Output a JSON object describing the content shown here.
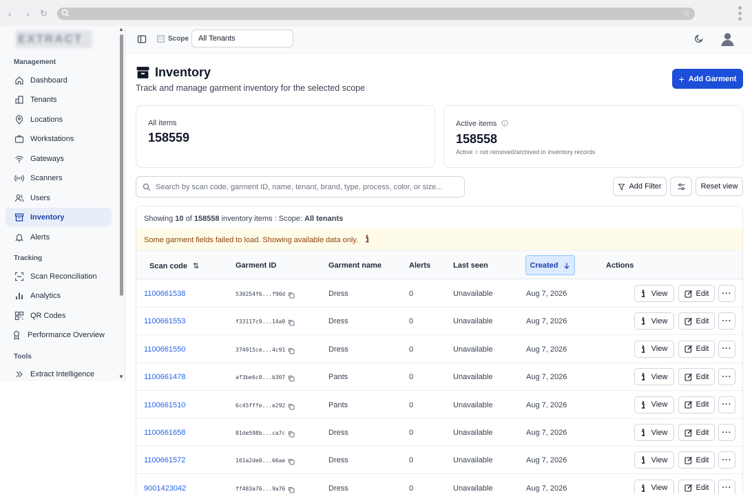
{
  "sidebar": {
    "logo_text": "EXTRACT",
    "sections": {
      "management": "Management",
      "tracking": "Tracking",
      "tools": "Tools"
    },
    "items": [
      {
        "label": "Dashboard",
        "icon": "home-icon"
      },
      {
        "label": "Tenants",
        "icon": "building-icon"
      },
      {
        "label": "Locations",
        "icon": "map-pin-icon"
      },
      {
        "label": "Workstations",
        "icon": "briefcase-icon"
      },
      {
        "label": "Gateways",
        "icon": "wifi-icon"
      },
      {
        "label": "Scanners",
        "icon": "radio-icon"
      },
      {
        "label": "Users",
        "icon": "users-icon"
      },
      {
        "label": "Inventory",
        "icon": "archive-icon"
      },
      {
        "label": "Alerts",
        "icon": "bell-icon"
      },
      {
        "label": "Scan Reconciliation",
        "icon": "scan-icon"
      },
      {
        "label": "Analytics",
        "icon": "bar-chart-icon"
      },
      {
        "label": "QR Codes",
        "icon": "qr-icon"
      },
      {
        "label": "Performance Overview",
        "icon": "award-icon"
      },
      {
        "label": "Extract Intelligence",
        "icon": "chevrons-right-icon"
      }
    ]
  },
  "header": {
    "scope_label": "Scope",
    "scope_value": "All Tenants"
  },
  "page": {
    "title": "Inventory",
    "subtitle": "Track and manage garment inventory for the selected scope",
    "add_button": "Add Garment"
  },
  "stats": {
    "all_label": "All items",
    "all_value": "158559",
    "active_label": "Active items",
    "active_value": "158558",
    "active_note": "Active = not removed/archived in inventory records"
  },
  "toolbar": {
    "search_placeholder": "Search by scan code, garment ID, name, tenant, brand, type, process, color, or size...",
    "add_filter": "Add Filter",
    "reset_view": "Reset view"
  },
  "table": {
    "showing_prefix": "Showing ",
    "showing_count": "10",
    "showing_of": " of ",
    "showing_total": "158558",
    "showing_suffix": " inventory items : Scope: ",
    "showing_scope": "All tenants",
    "warning": "Some garment fields failed to load. Showing available data only.",
    "columns": {
      "scan_code": "Scan code",
      "garment_id": "Garment ID",
      "garment_name": "Garment name",
      "alerts": "Alerts",
      "last_seen": "Last seen",
      "created": "Created",
      "actions": "Actions"
    },
    "view_label": "View",
    "edit_label": "Edit",
    "rows": [
      {
        "scan": "1100661538",
        "gid": "530254f6...f90d",
        "name": "Dress",
        "alerts": "0",
        "last_seen": "Unavailable",
        "created": "Aug 7, 2026"
      },
      {
        "scan": "1100661553",
        "gid": "f33117c9...14a9",
        "name": "Dress",
        "alerts": "0",
        "last_seen": "Unavailable",
        "created": "Aug 7, 2026"
      },
      {
        "scan": "1100661550",
        "gid": "374915ce...4c91",
        "name": "Dress",
        "alerts": "0",
        "last_seen": "Unavailable",
        "created": "Aug 7, 2026"
      },
      {
        "scan": "1100661478",
        "gid": "af3be6c0...b307",
        "name": "Pants",
        "alerts": "0",
        "last_seen": "Unavailable",
        "created": "Aug 7, 2026"
      },
      {
        "scan": "1100661510",
        "gid": "6c45fffe...e292",
        "name": "Pants",
        "alerts": "0",
        "last_seen": "Unavailable",
        "created": "Aug 7, 2026"
      },
      {
        "scan": "1100661658",
        "gid": "81de598b...ca7c",
        "name": "Dress",
        "alerts": "0",
        "last_seen": "Unavailable",
        "created": "Aug 7, 2026"
      },
      {
        "scan": "1100661572",
        "gid": "101a2de0...66ae",
        "name": "Dress",
        "alerts": "0",
        "last_seen": "Unavailable",
        "created": "Aug 7, 2026"
      },
      {
        "scan": "9001423042",
        "gid": "ff483a76...9a76",
        "name": "Dress",
        "alerts": "0",
        "last_seen": "Unavailable",
        "created": "Aug 7, 2026"
      }
    ]
  }
}
